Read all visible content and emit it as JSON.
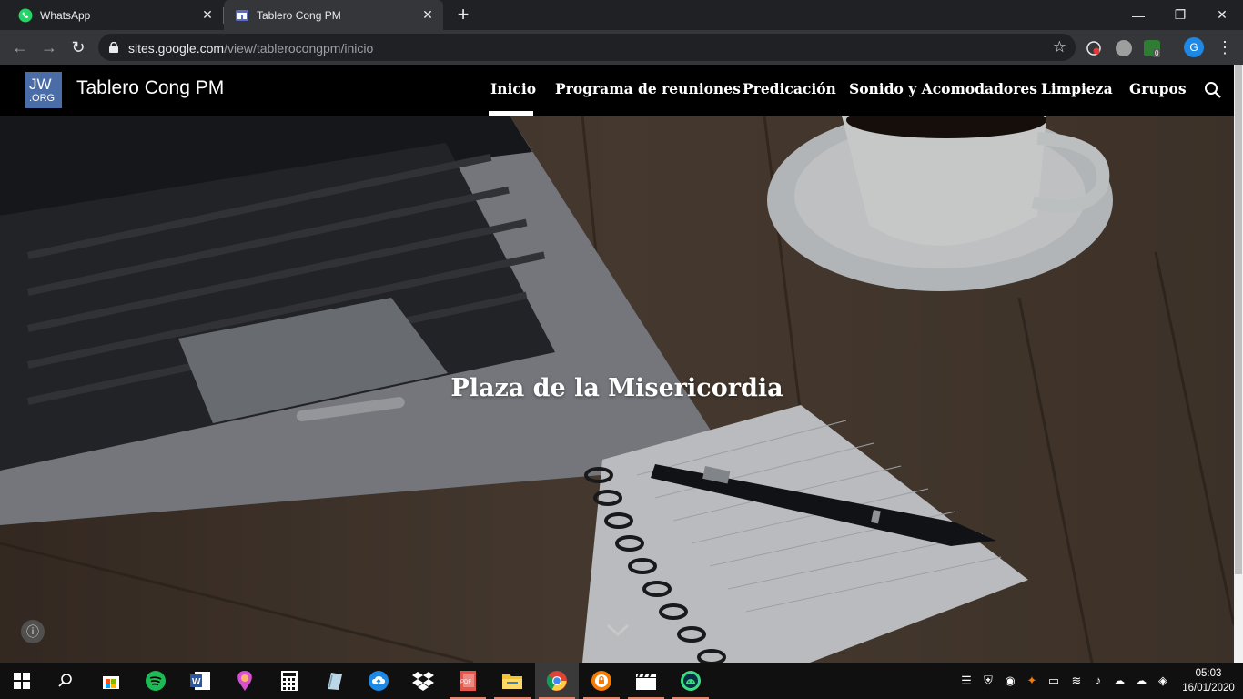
{
  "browser": {
    "tabs": [
      {
        "title": "WhatsApp",
        "icon": "whatsapp-icon",
        "active": false
      },
      {
        "title": "Tablero Cong PM",
        "icon": "google-sites-icon",
        "active": true
      }
    ],
    "url_host": "sites.google.com",
    "url_path": "/view/tablerocongpm/inicio",
    "profile_initial": "G",
    "extension_badge": "0"
  },
  "site": {
    "logo_line1": "JW",
    "logo_line2": ".ORG",
    "title": "Tablero Cong PM",
    "nav": [
      "Inicio",
      "Programa de reuniones",
      "Predicación",
      "Sonido y Acomodadores",
      "Limpieza",
      "Grupos"
    ],
    "active_nav": "Inicio"
  },
  "hero": {
    "title": "Plaza de la Misericordia"
  },
  "taskbar": {
    "apps": [
      "start",
      "search",
      "store",
      "spotify",
      "word",
      "paint-3d",
      "calculator",
      "sticky",
      "cloud-upload",
      "dropbox",
      "pdf",
      "file-explorer",
      "chrome",
      "vpn",
      "clapper",
      "android-studio"
    ],
    "time": "05:03",
    "date": "16/01/2020"
  },
  "colors": {
    "accent": "#e0866c",
    "chrome_dark": "#202124",
    "chrome_toolbar": "#35363a",
    "jw_blue": "#4a6da7"
  }
}
